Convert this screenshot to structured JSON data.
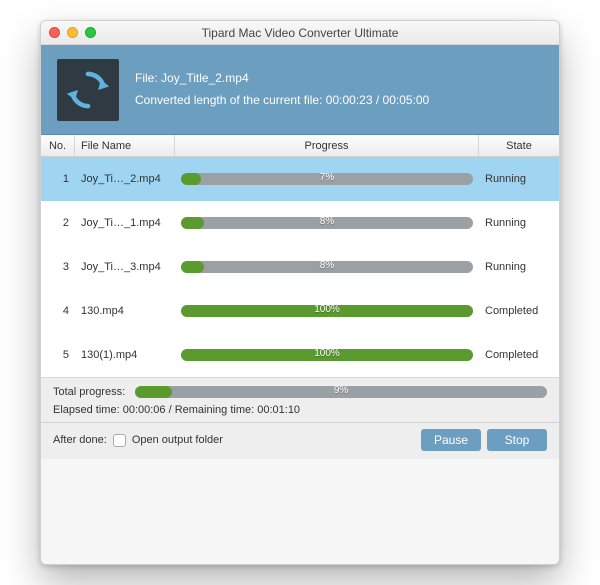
{
  "window": {
    "title": "Tipard Mac Video Converter Ultimate"
  },
  "banner": {
    "file_prefix": "File: ",
    "file_name": "Joy_Title_2.mp4",
    "progress_prefix": "Converted length of the current file: ",
    "elapsed": "00:00:23",
    "sep": " / ",
    "total": "00:05:00"
  },
  "columns": {
    "no": "No.",
    "name": "File Name",
    "progress": "Progress",
    "state": "State"
  },
  "rows": [
    {
      "no": "1",
      "name": "Joy_Ti…_2.mp4",
      "pct": 7,
      "pct_label": "7%",
      "state": "Running",
      "selected": true
    },
    {
      "no": "2",
      "name": "Joy_Ti…_1.mp4",
      "pct": 8,
      "pct_label": "8%",
      "state": "Running",
      "selected": false
    },
    {
      "no": "3",
      "name": "Joy_Ti…_3.mp4",
      "pct": 8,
      "pct_label": "8%",
      "state": "Running",
      "selected": false
    },
    {
      "no": "4",
      "name": "130.mp4",
      "pct": 100,
      "pct_label": "100%",
      "state": "Completed",
      "selected": false
    },
    {
      "no": "5",
      "name": "130(1).mp4",
      "pct": 100,
      "pct_label": "100%",
      "state": "Completed",
      "selected": false
    }
  ],
  "footer": {
    "total_label": "Total progress:",
    "total_pct": 9,
    "total_pct_label": "9%",
    "elapsed_label": "Elapsed time: ",
    "elapsed_value": "00:00:06",
    "remaining_label": " / Remaining time: ",
    "remaining_value": "00:01:10",
    "after_done_label": "After done:",
    "checkbox_label": "Open output folder",
    "checkbox_checked": false,
    "pause": "Pause",
    "stop": "Stop"
  }
}
